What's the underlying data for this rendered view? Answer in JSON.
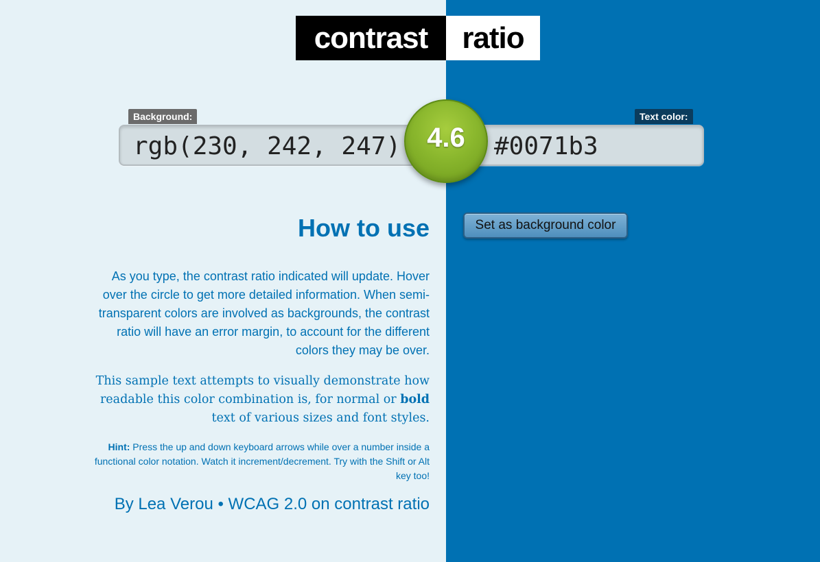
{
  "logo": {
    "left_word": "contrast",
    "right_word": "ratio"
  },
  "labels": {
    "background": "Background:",
    "text_color": "Text color:"
  },
  "inputs": {
    "background_value": "rgb(230, 242, 247)",
    "text_color_value": "#0071b3"
  },
  "ratio": {
    "value": "4.6",
    "color": "#8ab72d"
  },
  "colors": {
    "background": "#e6f2f7",
    "text": "#0071b3"
  },
  "buttons": {
    "set_background": "Set as background color"
  },
  "content": {
    "heading": "How to use",
    "para1": "As you type, the contrast ratio indicated will update. Hover over the circle to get more detailed information. When semi-transparent colors are involved as backgrounds, the contrast ratio will have an error margin, to account for the different colors they may be over.",
    "para2_before": "This sample text attempts to visually demonstrate how readable this color combination is, for normal or ",
    "para2_bold": "bold",
    "para2_after": " text of various sizes and font styles.",
    "hint_label": "Hint:",
    "hint_text": " Press the up and down keyboard arrows while over a number inside a functional color notation. Watch it increment/decrement. Try with the Shift or Alt key too!",
    "byline_author": "By Lea Verou",
    "byline_sep": " • ",
    "byline_link": "WCAG 2.0 on contrast ratio"
  }
}
